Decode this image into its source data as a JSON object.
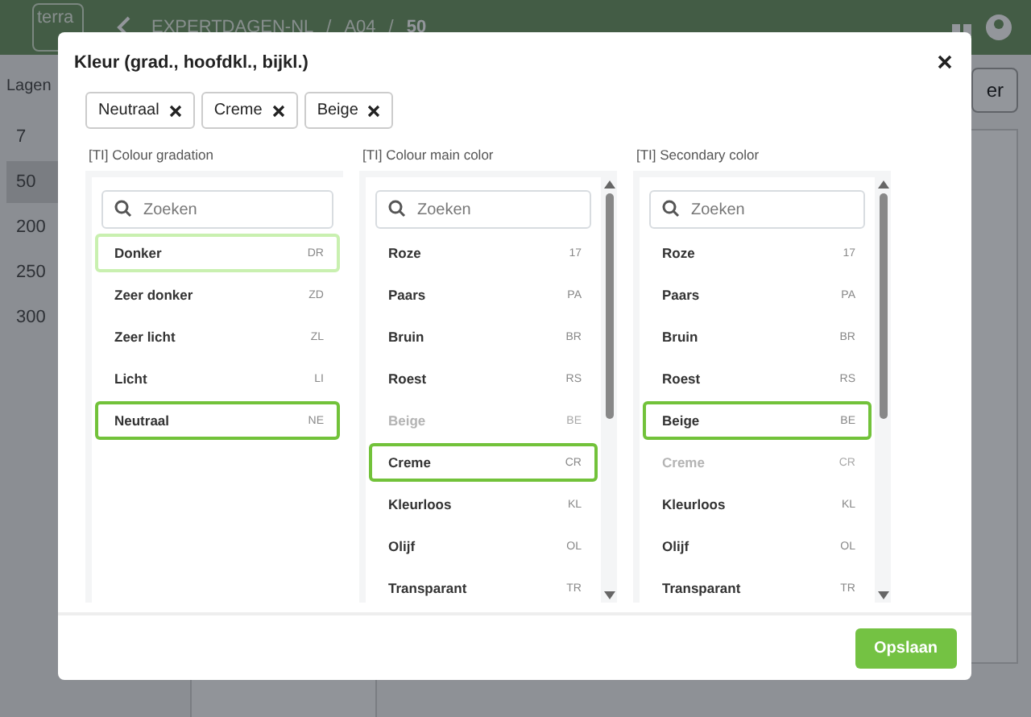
{
  "header": {
    "logo": "terra",
    "separator": "/",
    "breadcrumb": [
      {
        "label": "EXPERTDAGEN-NL",
        "current": false
      },
      {
        "label": "A04",
        "current": false
      },
      {
        "label": "50",
        "current": true
      }
    ]
  },
  "sidebar": {
    "title": "Lagen",
    "items": [
      {
        "label": "7",
        "selected": false
      },
      {
        "label": "50",
        "selected": true
      },
      {
        "label": "200",
        "selected": false
      },
      {
        "label": "250",
        "selected": false
      },
      {
        "label": "300",
        "selected": false
      }
    ]
  },
  "toolbar": {
    "button": "er"
  },
  "dialog": {
    "title": "Kleur (grad., hoofdkl., bijkl.)",
    "chips": [
      "Neutraal",
      "Creme",
      "Beige"
    ],
    "columns": [
      {
        "label": "[TI] Colour gradation",
        "search_placeholder": "Zoeken",
        "scrollbar": false,
        "items": [
          {
            "name": "Donker",
            "code": "DR",
            "selected": false,
            "focused": true,
            "disabled": false
          },
          {
            "name": "Zeer donker",
            "code": "ZD",
            "selected": false,
            "focused": false,
            "disabled": false
          },
          {
            "name": "Zeer licht",
            "code": "ZL",
            "selected": false,
            "focused": false,
            "disabled": false
          },
          {
            "name": "Licht",
            "code": "LI",
            "selected": false,
            "focused": false,
            "disabled": false
          },
          {
            "name": "Neutraal",
            "code": "NE",
            "selected": true,
            "focused": false,
            "disabled": false
          }
        ]
      },
      {
        "label": "[TI] Colour main color",
        "search_placeholder": "Zoeken",
        "scrollbar": true,
        "items": [
          {
            "name": "Roze",
            "code": "17",
            "selected": false,
            "focused": false,
            "disabled": false
          },
          {
            "name": "Paars",
            "code": "PA",
            "selected": false,
            "focused": false,
            "disabled": false
          },
          {
            "name": "Bruin",
            "code": "BR",
            "selected": false,
            "focused": false,
            "disabled": false
          },
          {
            "name": "Roest",
            "code": "RS",
            "selected": false,
            "focused": false,
            "disabled": false
          },
          {
            "name": "Beige",
            "code": "BE",
            "selected": false,
            "focused": false,
            "disabled": true
          },
          {
            "name": "Creme",
            "code": "CR",
            "selected": true,
            "focused": false,
            "disabled": false
          },
          {
            "name": "Kleurloos",
            "code": "KL",
            "selected": false,
            "focused": false,
            "disabled": false
          },
          {
            "name": "Olijf",
            "code": "OL",
            "selected": false,
            "focused": false,
            "disabled": false
          },
          {
            "name": "Transparant",
            "code": "TR",
            "selected": false,
            "focused": false,
            "disabled": false
          }
        ]
      },
      {
        "label": "[TI] Secondary color",
        "search_placeholder": "Zoeken",
        "scrollbar": true,
        "items": [
          {
            "name": "Roze",
            "code": "17",
            "selected": false,
            "focused": false,
            "disabled": false
          },
          {
            "name": "Paars",
            "code": "PA",
            "selected": false,
            "focused": false,
            "disabled": false
          },
          {
            "name": "Bruin",
            "code": "BR",
            "selected": false,
            "focused": false,
            "disabled": false
          },
          {
            "name": "Roest",
            "code": "RS",
            "selected": false,
            "focused": false,
            "disabled": false
          },
          {
            "name": "Beige",
            "code": "BE",
            "selected": true,
            "focused": false,
            "disabled": false
          },
          {
            "name": "Creme",
            "code": "CR",
            "selected": false,
            "focused": false,
            "disabled": true
          },
          {
            "name": "Kleurloos",
            "code": "KL",
            "selected": false,
            "focused": false,
            "disabled": false
          },
          {
            "name": "Olijf",
            "code": "OL",
            "selected": false,
            "focused": false,
            "disabled": false
          },
          {
            "name": "Transparant",
            "code": "TR",
            "selected": false,
            "focused": false,
            "disabled": false
          }
        ]
      }
    ],
    "save_button": "Opslaan"
  }
}
